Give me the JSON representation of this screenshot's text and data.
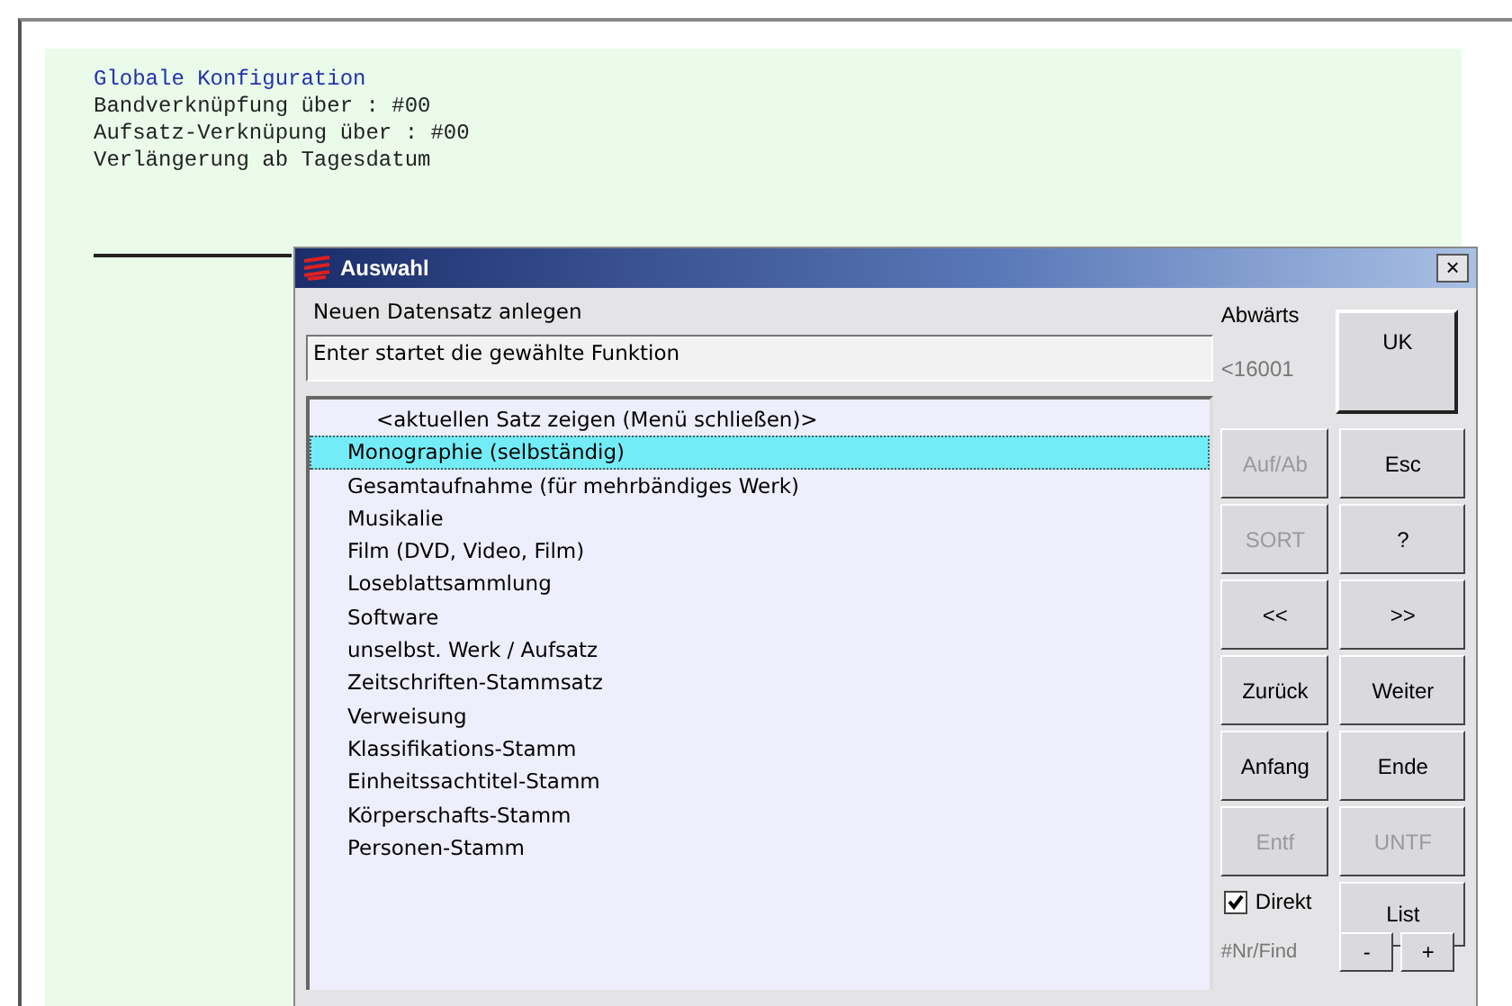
{
  "background": {
    "title": "Globale Konfiguration",
    "lines": [
      "Bandverknüpfung über    : #00",
      "Aufsatz-Verknüpung über : #00",
      "Verlängerung ab Tagesdatum"
    ]
  },
  "dialog": {
    "title": "Auswahl",
    "close": "×",
    "heading": "Neuen Datensatz anlegen",
    "hint_field": {
      "value": "Enter startet die gewählte Funktion"
    },
    "list": [
      {
        "label": "<aktuellen Satz zeigen (Menü schließen)>",
        "kind": "header",
        "selected": false
      },
      {
        "label": "Monographie (selbständig)",
        "kind": "item",
        "selected": true
      },
      {
        "label": "Gesamtaufnahme (für mehrbändiges Werk)",
        "kind": "item",
        "selected": false
      },
      {
        "label": "Musikalie",
        "kind": "item",
        "selected": false
      },
      {
        "label": "Film (DVD, Video, Film)",
        "kind": "item",
        "selected": false
      },
      {
        "label": "Loseblattsammlung",
        "kind": "item",
        "selected": false
      },
      {
        "label": "Software",
        "kind": "item",
        "selected": false
      },
      {
        "label": "unselbst. Werk / Aufsatz",
        "kind": "item",
        "selected": false
      },
      {
        "label": "Zeitschriften-Stammsatz",
        "kind": "item",
        "selected": false
      },
      {
        "label": "Verweisung",
        "kind": "item",
        "selected": false
      },
      {
        "label": "Klassifikations-Stamm",
        "kind": "item",
        "selected": false
      },
      {
        "label": "Einheitssachtitel-Stamm",
        "kind": "item",
        "selected": false
      },
      {
        "label": "Körperschafts-Stamm",
        "kind": "item",
        "selected": false
      },
      {
        "label": "Personen-Stamm",
        "kind": "item",
        "selected": false
      }
    ],
    "direction": "Abwärts",
    "counter": "<16001",
    "ok_button": {
      "label": "UK",
      "disabled": false
    },
    "buttons": [
      {
        "label": "Auf/Ab",
        "disabled": true
      },
      {
        "label": "Esc",
        "disabled": false
      },
      {
        "label": "SORT",
        "disabled": true
      },
      {
        "label": "?",
        "disabled": false
      },
      {
        "label": "<<",
        "disabled": false
      },
      {
        "label": ">>",
        "disabled": false
      },
      {
        "label": "Zurück",
        "disabled": false
      },
      {
        "label": "Weiter",
        "disabled": false
      },
      {
        "label": "Anfang",
        "disabled": false
      },
      {
        "label": "Ende",
        "disabled": false
      },
      {
        "label": "Entf",
        "disabled": true
      },
      {
        "label": "UNTF",
        "disabled": true
      }
    ],
    "direct_checkbox": {
      "label": "Direkt",
      "checked": true
    },
    "list_button": {
      "label": "List",
      "disabled": false
    },
    "find_label": "#Nr/Find",
    "minus_button": "-",
    "plus_button": "+"
  }
}
